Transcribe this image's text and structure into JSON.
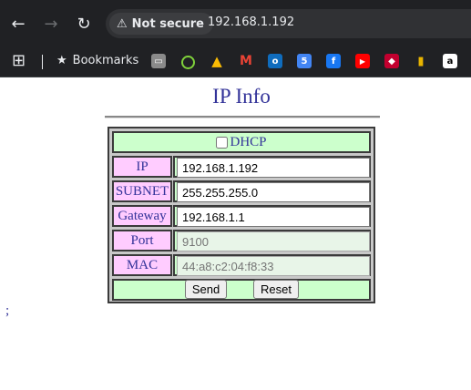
{
  "browser": {
    "security_label": "Not secure",
    "url": "192.168.1.192",
    "bookmarks_label": "Bookmarks"
  },
  "page": {
    "title": "IP Info",
    "dhcp_label": "DHCP",
    "dhcp_checked": false,
    "fields": [
      {
        "label": "IP",
        "value": "192.168.1.192"
      },
      {
        "label": "SUBNET",
        "value": "255.255.255.0"
      },
      {
        "label": "Gateway",
        "value": "192.168.1.1"
      },
      {
        "label": "Port",
        "placeholder": "9100"
      },
      {
        "label": "MAC",
        "placeholder": "44:a8:c2:04:f8:33"
      }
    ],
    "send_label": "Send",
    "reset_label": "Reset",
    "footer_text": ";"
  },
  "colors": {
    "chrome_bg": "#202124",
    "title_color": "#333399",
    "label_bg": "#ffccff",
    "row_bg": "#ccffcc"
  }
}
